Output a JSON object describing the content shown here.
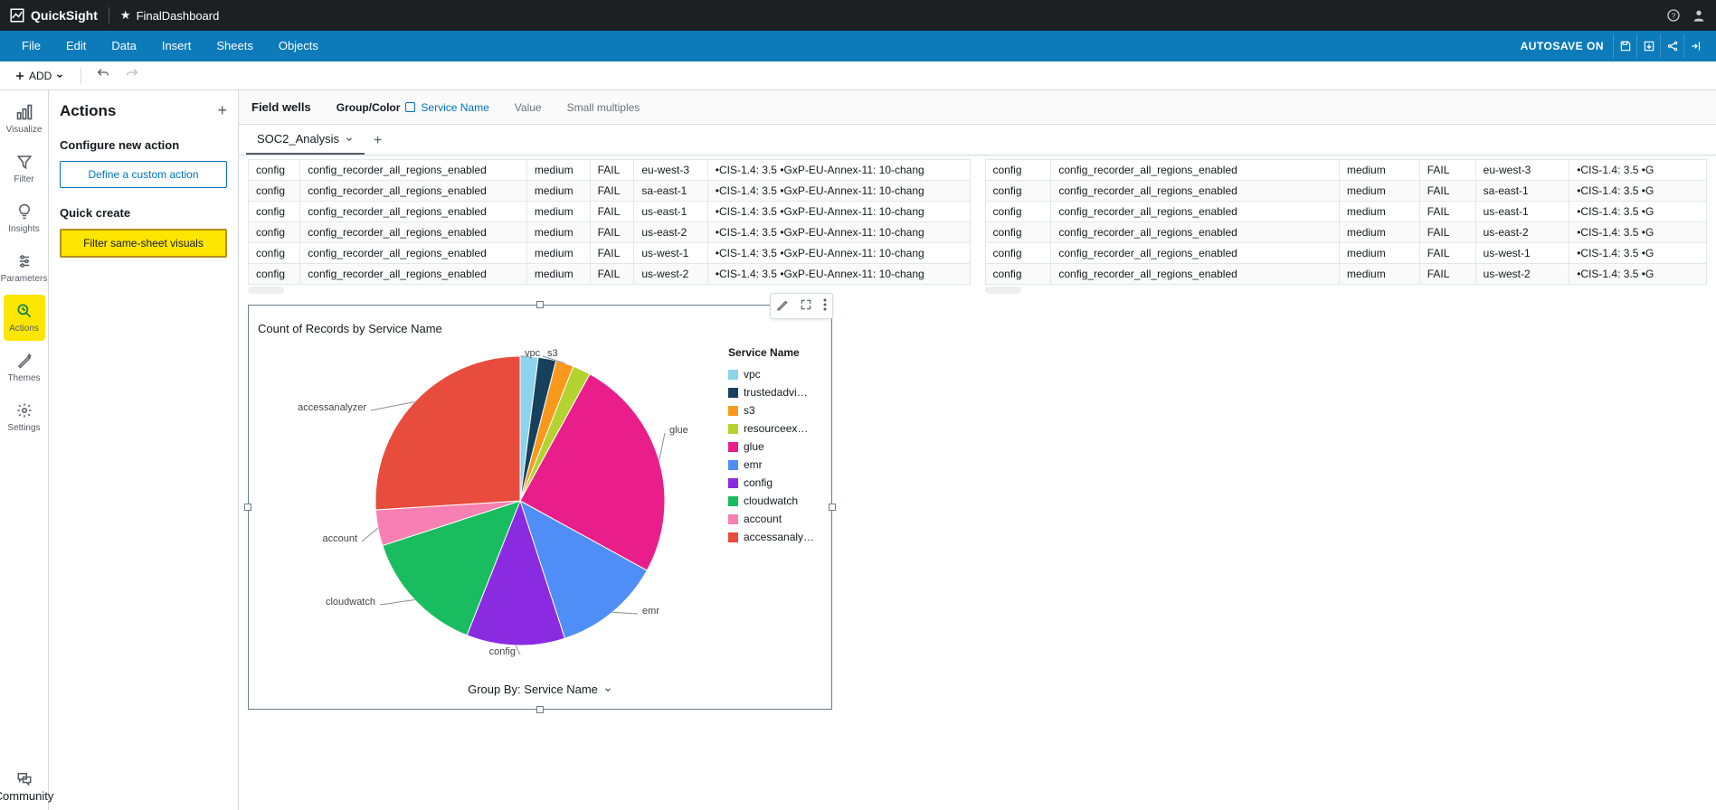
{
  "top": {
    "product": "QuickSight",
    "dashboard": "FinalDashboard"
  },
  "menu": [
    "File",
    "Edit",
    "Data",
    "Insert",
    "Sheets",
    "Objects"
  ],
  "autosave": "AUTOSAVE ON",
  "toolbar": {
    "add": "ADD"
  },
  "leftnav": [
    {
      "label": "Visualize",
      "name": "visualize-icon"
    },
    {
      "label": "Filter",
      "name": "filter-icon"
    },
    {
      "label": "Insights",
      "name": "insights-icon"
    },
    {
      "label": "Parameters",
      "name": "parameters-icon"
    },
    {
      "label": "Actions",
      "name": "actions-icon",
      "active": true
    },
    {
      "label": "Themes",
      "name": "themes-icon"
    },
    {
      "label": "Settings",
      "name": "settings-icon"
    }
  ],
  "community_label": "Community",
  "panel": {
    "title": "Actions",
    "configure_label": "Configure new action",
    "define_btn": "Define a custom action",
    "quick_label": "Quick create",
    "filter_btn": "Filter same-sheet visuals"
  },
  "fieldwells": {
    "label": "Field wells",
    "group_label": "Group/Color",
    "group_value": "Service Name",
    "value_label": "Value",
    "sm_label": "Small multiples"
  },
  "sheet": {
    "name": "SOC2_Analysis"
  },
  "table_left": [
    [
      "config",
      "config_recorder_all_regions_enabled",
      "medium",
      "FAIL",
      "eu-west-3",
      "•CIS-1.4: 3.5 •GxP-EU-Annex-11: 10-chang"
    ],
    [
      "config",
      "config_recorder_all_regions_enabled",
      "medium",
      "FAIL",
      "sa-east-1",
      "•CIS-1.4: 3.5 •GxP-EU-Annex-11: 10-chang"
    ],
    [
      "config",
      "config_recorder_all_regions_enabled",
      "medium",
      "FAIL",
      "us-east-1",
      "•CIS-1.4: 3.5 •GxP-EU-Annex-11: 10-chang"
    ],
    [
      "config",
      "config_recorder_all_regions_enabled",
      "medium",
      "FAIL",
      "us-east-2",
      "•CIS-1.4: 3.5 •GxP-EU-Annex-11: 10-chang"
    ],
    [
      "config",
      "config_recorder_all_regions_enabled",
      "medium",
      "FAIL",
      "us-west-1",
      "•CIS-1.4: 3.5 •GxP-EU-Annex-11: 10-chang"
    ],
    [
      "config",
      "config_recorder_all_regions_enabled",
      "medium",
      "FAIL",
      "us-west-2",
      "•CIS-1.4: 3.5 •GxP-EU-Annex-11: 10-chang"
    ]
  ],
  "table_right": [
    [
      "config",
      "config_recorder_all_regions_enabled",
      "medium",
      "FAIL",
      "eu-west-3",
      "•CIS-1.4: 3.5 •G"
    ],
    [
      "config",
      "config_recorder_all_regions_enabled",
      "medium",
      "FAIL",
      "sa-east-1",
      "•CIS-1.4: 3.5 •G"
    ],
    [
      "config",
      "config_recorder_all_regions_enabled",
      "medium",
      "FAIL",
      "us-east-1",
      "•CIS-1.4: 3.5 •G"
    ],
    [
      "config",
      "config_recorder_all_regions_enabled",
      "medium",
      "FAIL",
      "us-east-2",
      "•CIS-1.4: 3.5 •G"
    ],
    [
      "config",
      "config_recorder_all_regions_enabled",
      "medium",
      "FAIL",
      "us-west-1",
      "•CIS-1.4: 3.5 •G"
    ],
    [
      "config",
      "config_recorder_all_regions_enabled",
      "medium",
      "FAIL",
      "us-west-2",
      "•CIS-1.4: 3.5 •G"
    ]
  ],
  "chart": {
    "title": "Count of Records by Service Name",
    "groupby": "Group By: Service Name",
    "legend_title": "Service Name",
    "legend": [
      {
        "name": "vpc",
        "color": "#8bd4eb"
      },
      {
        "name": "trustedadvi…",
        "color": "#16405b"
      },
      {
        "name": "s3",
        "color": "#f8991e"
      },
      {
        "name": "resourceex…",
        "color": "#b4d330"
      },
      {
        "name": "glue",
        "color": "#e91e8b"
      },
      {
        "name": "emr",
        "color": "#4f8ef7"
      },
      {
        "name": "config",
        "color": "#8a2be2"
      },
      {
        "name": "cloudwatch",
        "color": "#1abc60"
      },
      {
        "name": "account",
        "color": "#f77fb1"
      },
      {
        "name": "accessanaly…",
        "color": "#e74c3c"
      }
    ],
    "slice_labels": [
      "vpc",
      "s3",
      "glue",
      "emr",
      "config",
      "cloudwatch",
      "account",
      "accessanalyzer"
    ]
  },
  "chart_data": {
    "type": "pie",
    "title": "Count of Records by Service Name",
    "categories": [
      "accessanalyzer",
      "glue",
      "emr",
      "config",
      "cloudwatch",
      "account",
      "vpc",
      "trustedadvisor",
      "s3",
      "resourceexplorer"
    ],
    "values": [
      26,
      25,
      12,
      11,
      14,
      4,
      2,
      2,
      2,
      2
    ],
    "colors": [
      "#e74c3c",
      "#e91e8b",
      "#4f8ef7",
      "#8a2be2",
      "#1abc60",
      "#f77fb1",
      "#8bd4eb",
      "#16405b",
      "#f8991e",
      "#b4d330"
    ],
    "groupby": "Service Name"
  }
}
